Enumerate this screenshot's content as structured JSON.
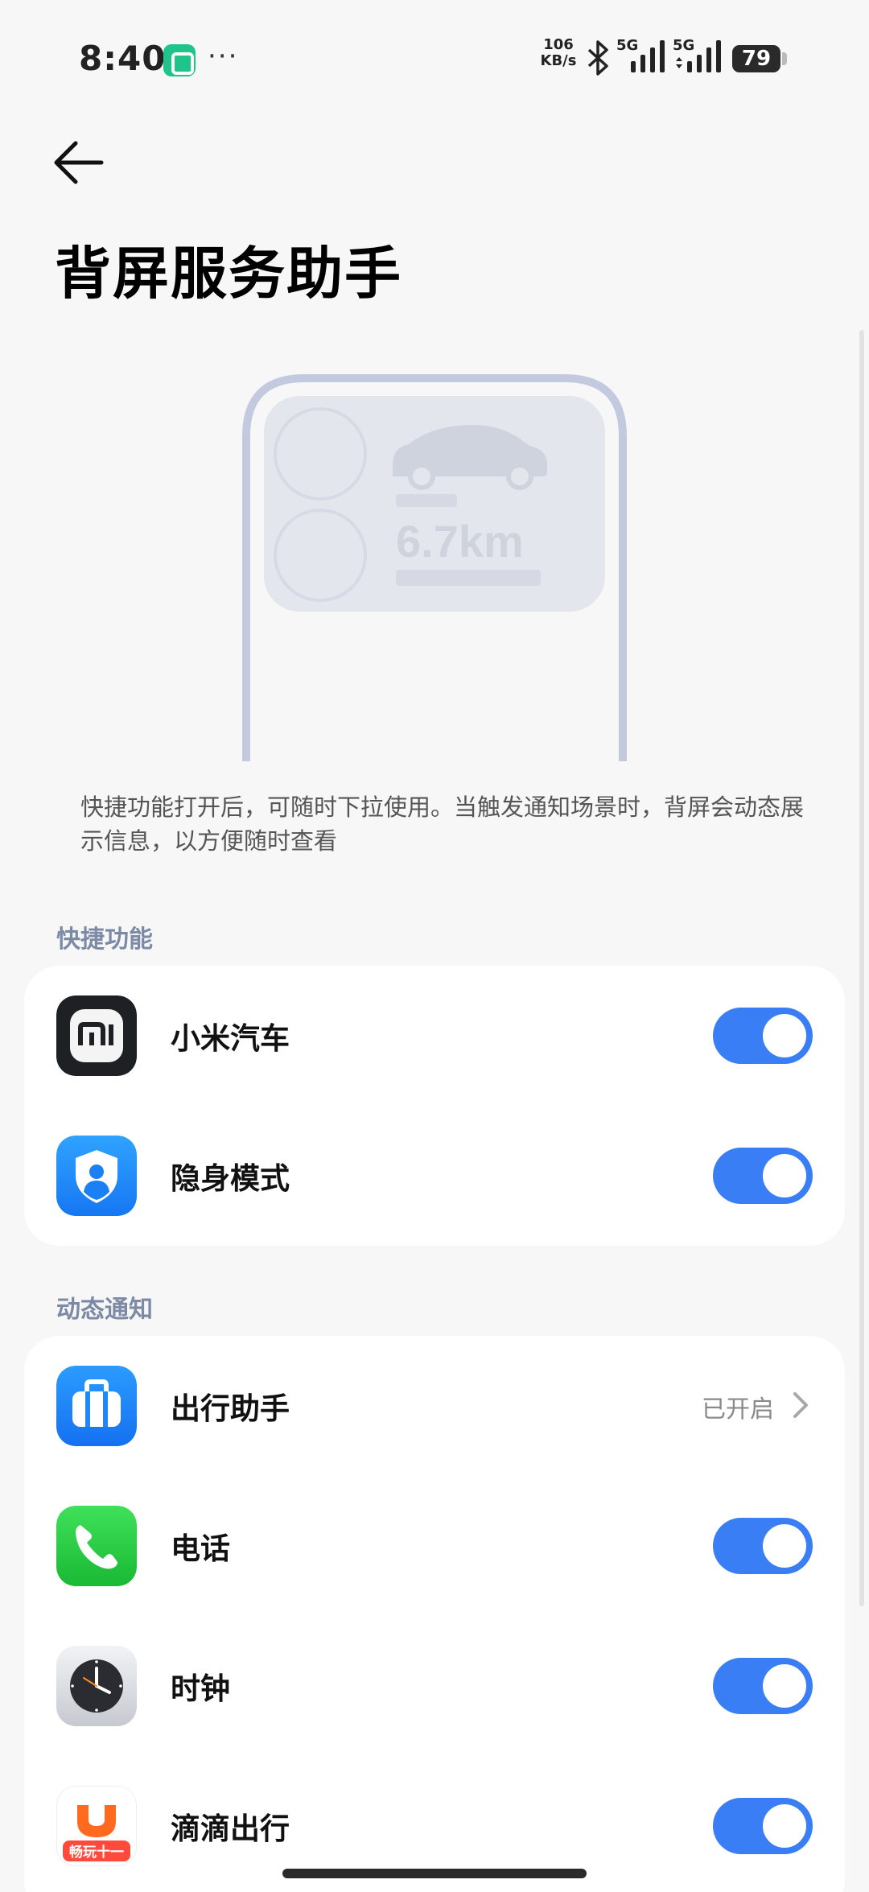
{
  "status_bar": {
    "time": "8:40",
    "more_dots": "···",
    "net_speed_value": "106",
    "net_speed_unit": "KB/s",
    "sim1_type": "5G",
    "sim2_type": "5G",
    "battery": "79"
  },
  "header": {
    "title": "背屏服务助手"
  },
  "illustration": {
    "distance": "6.7km"
  },
  "description": "快捷功能打开后，可随时下拉使用。当触发通知场景时，背屏会动态展示信息，以方便随时查看",
  "quick_functions": {
    "title": "快捷功能",
    "items": [
      {
        "label": "小米汽车",
        "enabled": true,
        "icon": "xiaomi-car-icon"
      },
      {
        "label": "隐身模式",
        "enabled": true,
        "icon": "incognito-shield-icon"
      }
    ]
  },
  "dynamic_notifications": {
    "title": "动态通知",
    "items": [
      {
        "label": "出行助手",
        "status": "已开启",
        "icon": "travel-assistant-icon"
      },
      {
        "label": "电话",
        "enabled": true,
        "icon": "phone-icon"
      },
      {
        "label": "时钟",
        "enabled": true,
        "icon": "clock-icon"
      },
      {
        "label": "滴滴出行",
        "enabled": true,
        "icon": "didi-icon"
      }
    ]
  },
  "didi_badge_text": "畅玩十一",
  "colors": {
    "background": "#f7f7f7",
    "accent": "#3a7ef5",
    "section_title": "#7c8aa6"
  }
}
